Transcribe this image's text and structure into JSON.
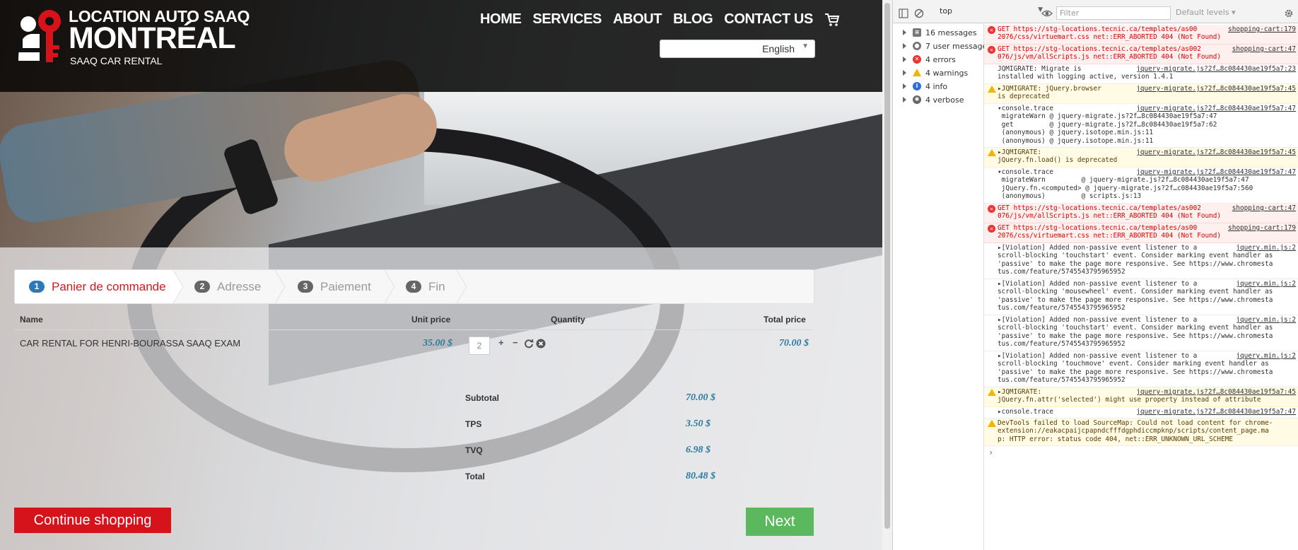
{
  "site": {
    "logo": {
      "line1": "LOCATION AUTO SAAQ",
      "line2": "MONTRÉAL",
      "line3": "SAAQ CAR RENTAL"
    },
    "nav": [
      {
        "label": "HOME",
        "name": "nav-home"
      },
      {
        "label": "SERVICES",
        "name": "nav-services"
      },
      {
        "label": "ABOUT",
        "name": "nav-about"
      },
      {
        "label": "BLOG",
        "name": "nav-blog"
      },
      {
        "label": "CONTACT US",
        "name": "nav-contact-us"
      }
    ],
    "language": "English",
    "steps": [
      {
        "num": "1",
        "label": "Panier de commande"
      },
      {
        "num": "2",
        "label": "Adresse"
      },
      {
        "num": "3",
        "label": "Paiement"
      },
      {
        "num": "4",
        "label": "Fin"
      }
    ],
    "table": {
      "headers": {
        "name": "Name",
        "unit_price": "Unit price",
        "quantity": "Quantity",
        "total_price": "Total price"
      },
      "row": {
        "name": "CAR RENTAL FOR HENRI-BOURASSA SAAQ EXAM",
        "unit_price": "35.00 $",
        "quantity": "2",
        "plus": "+",
        "minus": "−",
        "total": "70.00 $"
      }
    },
    "totals": [
      {
        "label": "Subtotal",
        "value": "70.00 $"
      },
      {
        "label": "TPS",
        "value": "3.50 $"
      },
      {
        "label": "TVQ",
        "value": "6.98 $"
      },
      {
        "label": "Total",
        "value": "80.48 $"
      }
    ],
    "buttons": {
      "continue": "Continue shopping",
      "next": "Next"
    }
  },
  "devtools": {
    "context": "top",
    "filter_placeholder": "Filter",
    "levels": "Default levels ▾",
    "sidebar": [
      {
        "label": "16 messages",
        "icon": "list-icon",
        "color": "#555555"
      },
      {
        "label": "7 user messages",
        "icon": "user-icon",
        "color": "#555555"
      },
      {
        "label": "4 errors",
        "icon": "error-icon",
        "color": "#e33333"
      },
      {
        "label": "4 warnings",
        "icon": "warning-icon",
        "color": "#f2b600"
      },
      {
        "label": "4 info",
        "icon": "info-icon",
        "color": "#2c6ed8"
      },
      {
        "label": "4 verbose",
        "icon": "bug-icon",
        "color": "#555555"
      }
    ],
    "messages": [
      {
        "type": "err",
        "lines": [
          "GET https://stg-locations.tecnic.ca/templates/as00",
          "2076/css/virtuemart.css net::ERR_ABORTED 404 (Not Found)"
        ],
        "src": "shopping-cart:179"
      },
      {
        "type": "err",
        "lines": [
          "GET https://stg-locations.tecnic.ca/templates/as002",
          "076/js/vm/allScripts.js net::ERR_ABORTED 404 (Not Found)"
        ],
        "src": "shopping-cart:47"
      },
      {
        "type": "log",
        "lines": [
          "JQMIGRATE: Migrate is",
          "installed with logging active, version 1.4.1"
        ],
        "src": "jquery-migrate.js?2f…8c084430ae19f5a7:23"
      },
      {
        "type": "warn",
        "lines": [
          "▸JQMIGRATE: jQuery.browser",
          "is deprecated"
        ],
        "src": "jquery-migrate.js?2f…8c084430ae19f5a7:45"
      },
      {
        "type": "log",
        "lines": [
          "▾console.trace",
          " migrateWarn @ jquery-migrate.js?2f…8c084430ae19f5a7:47",
          " get         @ jquery-migrate.js?2f…8c084430ae19f5a7:62",
          " (anonymous) @ jquery.isotope.min.js:11",
          " (anonymous) @ jquery.isotope.min.js:11"
        ],
        "src": "jquery-migrate.js?2f…8c084430ae19f5a7:47"
      },
      {
        "type": "warn",
        "lines": [
          "▸JQMIGRATE:",
          "jQuery.fn.load() is deprecated"
        ],
        "src": "jquery-migrate.js?2f…8c084430ae19f5a7:45"
      },
      {
        "type": "log",
        "lines": [
          "▾console.trace",
          " migrateWarn         @ jquery-migrate.js?2f…8c084430ae19f5a7:47",
          " jQuery.fn.<computed> @ jquery-migrate.js?2f…c084430ae19f5a7:560",
          " (anonymous)         @ scripts.js:13"
        ],
        "src": "jquery-migrate.js?2f…8c084430ae19f5a7:47"
      },
      {
        "type": "err",
        "lines": [
          "GET https://stg-locations.tecnic.ca/templates/as002",
          "076/js/vm/allScripts.js net::ERR_ABORTED 404 (Not Found)"
        ],
        "src": "shopping-cart:47"
      },
      {
        "type": "err",
        "lines": [
          "GET https://stg-locations.tecnic.ca/templates/as00",
          "2076/css/virtuemart.css net::ERR_ABORTED 404 (Not Found)"
        ],
        "src": "shopping-cart:179"
      },
      {
        "type": "log",
        "lines": [
          "▸[Violation] Added non-passive event listener to a",
          "scroll-blocking 'touchstart' event. Consider marking event handler as",
          "'passive' to make the page more responsive. See https://www.chromesta",
          "tus.com/feature/5745543795965952"
        ],
        "src": "jquery.min.js:2"
      },
      {
        "type": "log",
        "lines": [
          "▸[Violation] Added non-passive event listener to a",
          "scroll-blocking 'mousewheel' event. Consider marking event handler as",
          "'passive' to make the page more responsive. See https://www.chromesta",
          "tus.com/feature/5745543795965952"
        ],
        "src": "jquery.min.js:2"
      },
      {
        "type": "log",
        "lines": [
          "▸[Violation] Added non-passive event listener to a",
          "scroll-blocking 'touchstart' event. Consider marking event handler as",
          "'passive' to make the page more responsive. See https://www.chromesta",
          "tus.com/feature/5745543795965952"
        ],
        "src": "jquery.min.js:2"
      },
      {
        "type": "log",
        "lines": [
          "▸[Violation] Added non-passive event listener to a",
          "scroll-blocking 'touchmove' event. Consider marking event handler as",
          "'passive' to make the page more responsive. See https://www.chromesta",
          "tus.com/feature/5745543795965952"
        ],
        "src": "jquery.min.js:2"
      },
      {
        "type": "warn",
        "lines": [
          "▸JQMIGRATE:",
          "jQuery.fn.attr('selected') might use property instead of attribute"
        ],
        "src": "jquery-migrate.js?2f…8c084430ae19f5a7:45"
      },
      {
        "type": "log",
        "lines": [
          "▸console.trace"
        ],
        "src": "jquery-migrate.js?2f…8c084430ae19f5a7:47"
      },
      {
        "type": "warn",
        "lines": [
          "DevTools failed to load SourceMap: Could not load content for chrome-",
          "extension://eakacpaijcpapndcfffdgphdiccmpknp/scripts/content_page.ma",
          "p: HTTP error: status code 404, net::ERR_UNKNOWN_URL_SCHEME"
        ],
        "src": ""
      }
    ]
  }
}
